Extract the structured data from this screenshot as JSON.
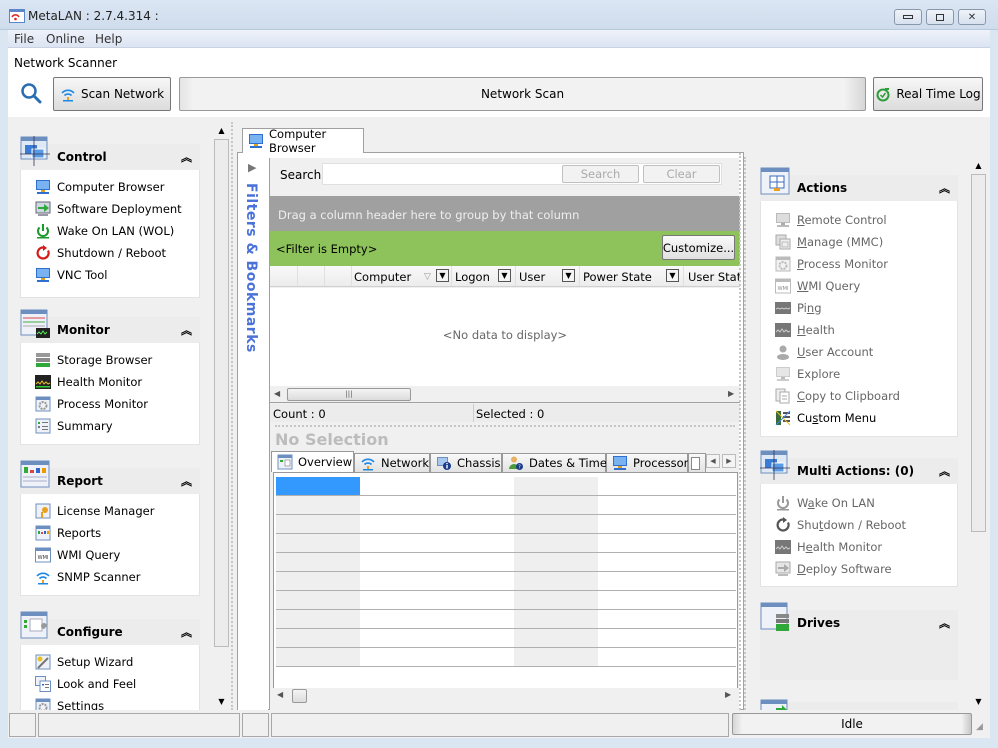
{
  "window": {
    "title": "MetaLAN : 2.7.4.314 :",
    "controls": {
      "minimize": "–",
      "maximize": "▭",
      "close": "✕"
    }
  },
  "menu": [
    "File",
    "Online",
    "Help"
  ],
  "toolbar": {
    "title": "Network Scanner",
    "search_icon": "magnifier-icon",
    "scan_button": "Scan Network",
    "progress_label": "Network Scan",
    "realtime_button": "Real Time Log"
  },
  "left_panel": {
    "groups": [
      {
        "title": "Control",
        "collapse": "⌃⌃",
        "items": [
          {
            "label": "Computer Browser",
            "icon": "computer-icon"
          },
          {
            "label": "Software Deployment",
            "icon": "deploy-icon"
          },
          {
            "label": "Wake On LAN (WOL)",
            "icon": "power-icon"
          },
          {
            "label": "Shutdown / Reboot",
            "icon": "reboot-icon"
          },
          {
            "label": "VNC Tool",
            "icon": "monitor-icon"
          }
        ]
      },
      {
        "title": "Monitor",
        "collapse": "⌃⌃",
        "items": [
          {
            "label": "Storage Browser",
            "icon": "storage-icon"
          },
          {
            "label": "Health Monitor",
            "icon": "health-icon"
          },
          {
            "label": "Process Monitor",
            "icon": "gear-icon"
          },
          {
            "label": "Summary",
            "icon": "summary-icon"
          }
        ]
      },
      {
        "title": "Report",
        "collapse": "⌃⌃",
        "items": [
          {
            "label": "License Manager",
            "icon": "key-icon"
          },
          {
            "label": "Reports",
            "icon": "report-icon"
          },
          {
            "label": "WMI Query",
            "icon": "wmi-icon"
          },
          {
            "label": "SNMP Scanner",
            "icon": "wifi-icon"
          }
        ]
      },
      {
        "title": "Configure",
        "collapse": "⌃⌃",
        "items": [
          {
            "label": "Setup Wizard",
            "icon": "wizard-icon"
          },
          {
            "label": "Look and Feel",
            "icon": "look-icon"
          },
          {
            "label": "Settings",
            "icon": "settings-icon"
          }
        ]
      }
    ]
  },
  "center": {
    "tab_label": "Computer Browser",
    "filters_label": "Filters & Bookmarks",
    "search_label": "Search",
    "search_value": "",
    "search_button": "Search",
    "clear_button": "Clear",
    "group_hint": "Drag a column header here to group by that column",
    "filter_text": "<Filter is Empty>",
    "customize_button": "Customize...",
    "columns": [
      "Computer",
      "Logon",
      "User",
      "Power State",
      "User State"
    ],
    "no_data": "<No data to display>",
    "count": "Count : 0",
    "selected": "Selected : 0",
    "selection_title": "No Selection",
    "detail_tabs": [
      {
        "label": "Overview",
        "icon": "overview-icon",
        "active": true
      },
      {
        "label": "Network",
        "icon": "wifi-icon"
      },
      {
        "label": "Chassis",
        "icon": "chassis-icon"
      },
      {
        "label": "Dates & Times",
        "icon": "user-info-icon"
      },
      {
        "label": "Processor",
        "icon": "processor-icon"
      }
    ]
  },
  "right_panel": {
    "actions": {
      "title": "Actions",
      "items": [
        {
          "pre": "",
          "u": "R",
          "post": "emote Control",
          "enabled": false
        },
        {
          "pre": "",
          "u": "M",
          "post": "anage (MMC)",
          "enabled": false
        },
        {
          "pre": "",
          "u": "P",
          "post": "rocess Monitor",
          "enabled": false
        },
        {
          "pre": "",
          "u": "W",
          "post": "MI Query",
          "enabled": false
        },
        {
          "pre": "Pi",
          "u": "n",
          "post": "g",
          "enabled": false
        },
        {
          "pre": "",
          "u": "H",
          "post": "ealth",
          "enabled": false
        },
        {
          "pre": "",
          "u": "U",
          "post": "ser Account",
          "enabled": false
        },
        {
          "pre": "Explore",
          "u": "",
          "post": "",
          "enabled": false
        },
        {
          "pre": "",
          "u": "C",
          "post": "opy to Clipboard",
          "enabled": false
        },
        {
          "pre": "Cu",
          "u": "s",
          "post": "tom Menu",
          "enabled": true
        }
      ]
    },
    "multi_actions": {
      "title": "Multi Actions: (0)",
      "items": [
        {
          "pre": "W",
          "u": "a",
          "post": "ke On LAN"
        },
        {
          "pre": "Shu",
          "u": "t",
          "post": "down / Reboot"
        },
        {
          "pre": "H",
          "u": "e",
          "post": "alth Monitor"
        },
        {
          "pre": "",
          "u": "D",
          "post": "eploy Software"
        }
      ]
    },
    "drives": {
      "title": "Drives"
    }
  },
  "statusbar": {
    "state": "Idle"
  },
  "colors": {
    "accent_blue": "#3399ff",
    "filter_green": "#8dc35a",
    "group_gray": "#a0a0a0",
    "filters_text": "#4a72d8"
  }
}
